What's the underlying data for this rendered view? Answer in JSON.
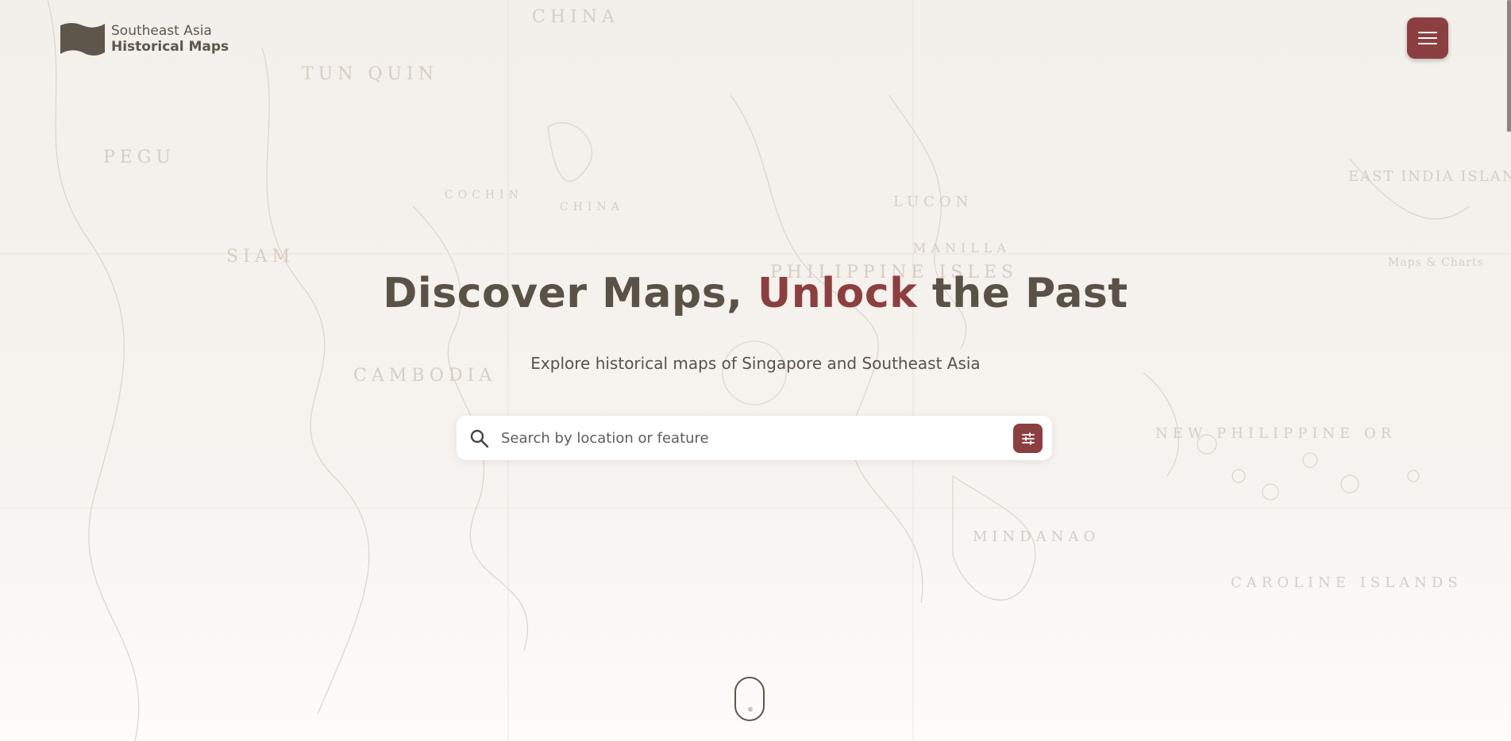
{
  "brand": {
    "line1": "Southeast Asia",
    "line2": "Historical Maps",
    "logo_icon": "map-flag-icon"
  },
  "header": {
    "menu_icon": "hamburger-menu-icon"
  },
  "hero": {
    "title_part1": "Discover Maps, ",
    "title_accent": "Unlock",
    "title_part2": " the Past",
    "subtitle": "Explore historical maps of Singapore and Southeast Asia"
  },
  "search": {
    "placeholder": "Search by location or feature",
    "value": "",
    "search_icon": "search-icon",
    "filter_icon": "filter-sliders-icon"
  },
  "scroll_indicator_icon": "mouse-scroll-icon",
  "colors": {
    "accent": "#8c3f40",
    "text_dark": "#5a5147",
    "background": "#f4f0ec"
  },
  "map_labels": [
    "CHINA",
    "TUN QUIN",
    "PEGU",
    "SIAM",
    "CAMBODIA",
    "COCHIN",
    "CHINA",
    "LUCON",
    "MANILLA",
    "PHILIPPINE ISLES",
    "NEW PHILIPPINE OR",
    "MINDANAO",
    "CAROLINE ISLANDS",
    "EAST INDIA ISLANDS",
    "Maps & Charts"
  ]
}
